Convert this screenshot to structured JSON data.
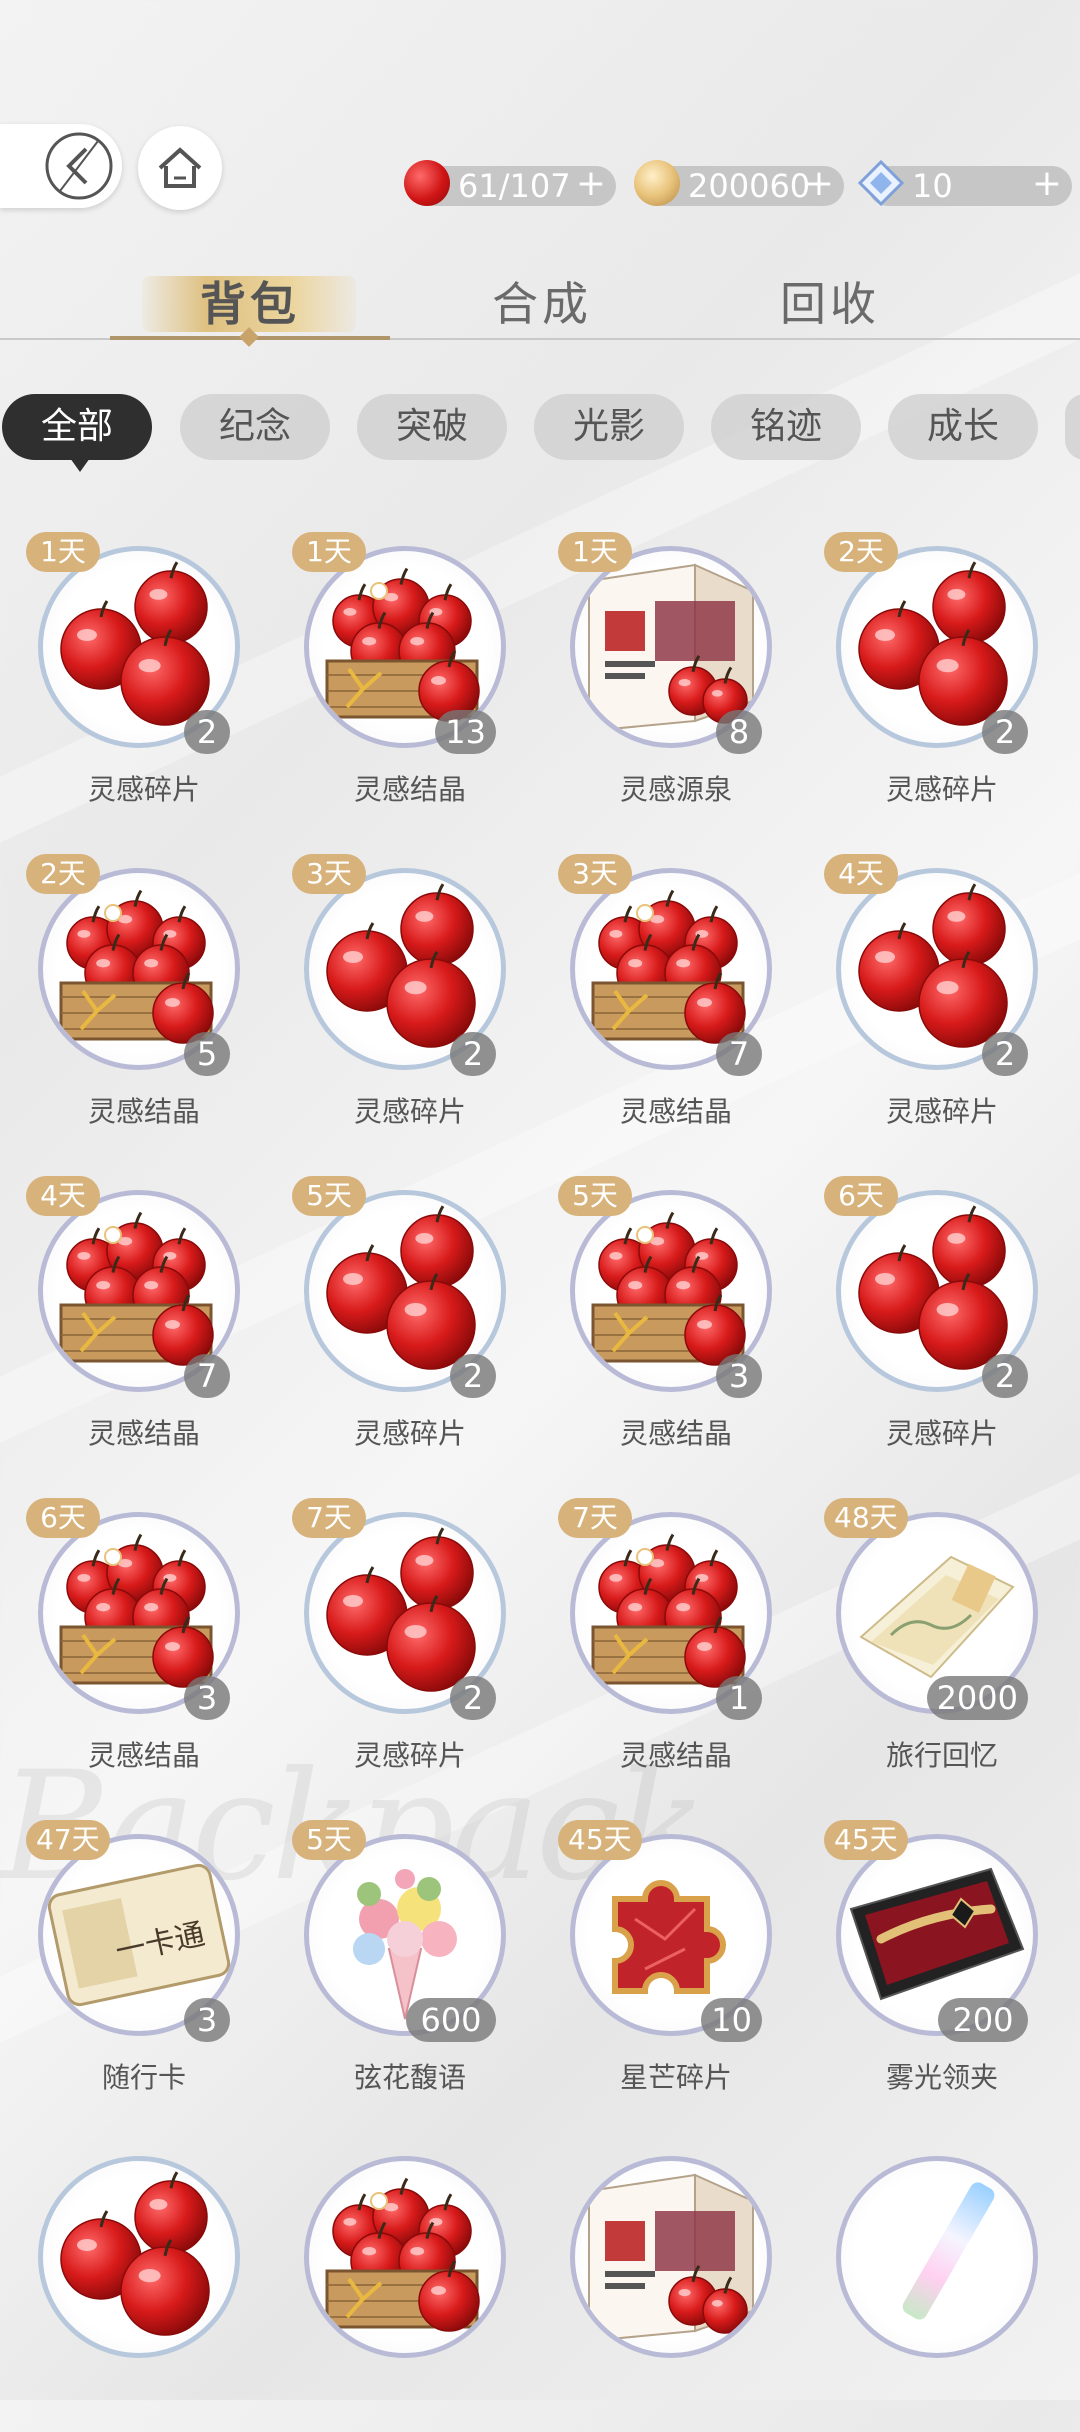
{
  "header": {
    "resources": [
      {
        "icon": "apple-icon",
        "value": "61/107",
        "plus": "+"
      },
      {
        "icon": "coin-icon",
        "value": "200060",
        "plus": "+"
      },
      {
        "icon": "gem-icon",
        "value": "10",
        "plus": "+"
      }
    ]
  },
  "tabs": [
    {
      "label": "背包",
      "active": true
    },
    {
      "label": "合成",
      "active": false
    },
    {
      "label": "回收",
      "active": false
    }
  ],
  "filters": [
    {
      "label": "全部",
      "active": true
    },
    {
      "label": "纪念"
    },
    {
      "label": "突破"
    },
    {
      "label": "光影"
    },
    {
      "label": "铭迹"
    },
    {
      "label": "成长"
    }
  ],
  "items": [
    {
      "days": "1天",
      "count": "2",
      "name": "灵感碎片",
      "icon": "apples-icon"
    },
    {
      "days": "1天",
      "count": "13",
      "name": "灵感结晶",
      "icon": "apple-basket-icon"
    },
    {
      "days": "1天",
      "count": "8",
      "name": "灵感源泉",
      "icon": "apple-box-icon"
    },
    {
      "days": "2天",
      "count": "2",
      "name": "灵感碎片",
      "icon": "apples-icon"
    },
    {
      "days": "2天",
      "count": "5",
      "name": "灵感结晶",
      "icon": "apple-basket-icon"
    },
    {
      "days": "3天",
      "count": "2",
      "name": "灵感碎片",
      "icon": "apples-icon"
    },
    {
      "days": "3天",
      "count": "7",
      "name": "灵感结晶",
      "icon": "apple-basket-icon"
    },
    {
      "days": "4天",
      "count": "2",
      "name": "灵感碎片",
      "icon": "apples-icon"
    },
    {
      "days": "4天",
      "count": "7",
      "name": "灵感结晶",
      "icon": "apple-basket-icon"
    },
    {
      "days": "5天",
      "count": "2",
      "name": "灵感碎片",
      "icon": "apples-icon"
    },
    {
      "days": "5天",
      "count": "3",
      "name": "灵感结晶",
      "icon": "apple-basket-icon"
    },
    {
      "days": "6天",
      "count": "2",
      "name": "灵感碎片",
      "icon": "apples-icon"
    },
    {
      "days": "6天",
      "count": "3",
      "name": "灵感结晶",
      "icon": "apple-basket-icon"
    },
    {
      "days": "7天",
      "count": "2",
      "name": "灵感碎片",
      "icon": "apples-icon"
    },
    {
      "days": "7天",
      "count": "1",
      "name": "灵感结晶",
      "icon": "apple-basket-icon"
    },
    {
      "days": "48天",
      "count": "2000",
      "name": "旅行回忆",
      "icon": "postcard-icon"
    },
    {
      "days": "47天",
      "count": "3",
      "name": "随行卡",
      "icon": "transit-card-icon"
    },
    {
      "days": "5天",
      "count": "600",
      "name": "弦花馥语",
      "icon": "bouquet-icon"
    },
    {
      "days": "45天",
      "count": "10",
      "name": "星芒碎片",
      "icon": "puzzle-piece-icon"
    },
    {
      "days": "45天",
      "count": "200",
      "name": "雾光领夹",
      "icon": "tie-clip-icon"
    },
    {
      "days": "",
      "count": "",
      "name": "",
      "icon": "apples-icon"
    },
    {
      "days": "",
      "count": "",
      "name": "",
      "icon": "apple-basket-icon"
    },
    {
      "days": "",
      "count": "",
      "name": "",
      "icon": "apple-box-icon"
    },
    {
      "days": "",
      "count": "",
      "name": "",
      "icon": "pen-icon"
    }
  ],
  "card_text": "一卡通",
  "colors": {
    "badge": "#d7b27a",
    "ring": "#b9bbd6",
    "accent": "#b0956b",
    "chip_active": "#2f2f2f"
  }
}
